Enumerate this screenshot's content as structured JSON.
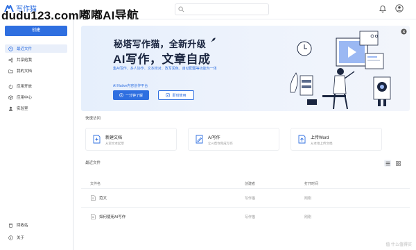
{
  "app": {
    "logo_text": "写作猫",
    "watermark": "dudu123.com嘟嘟AI导航"
  },
  "search": {
    "placeholder": ""
  },
  "sidebar": {
    "create_label": "创建",
    "items": [
      {
        "label": "最近文件",
        "icon": "clock-icon",
        "active": true
      },
      {
        "label": "共享给我",
        "icon": "share-icon",
        "active": false
      },
      {
        "label": "我的文档",
        "icon": "folder-icon",
        "active": false
      },
      {
        "label": "应用开放",
        "icon": "power-icon",
        "active": false
      },
      {
        "label": "应用中心",
        "icon": "box-icon",
        "active": false
      },
      {
        "label": "实验室",
        "icon": "user-icon",
        "active": false
      }
    ],
    "bottom_items": [
      {
        "label": "回收站",
        "icon": "trash-icon"
      },
      {
        "label": "关于",
        "icon": "info-icon"
      }
    ]
  },
  "banner": {
    "title1": "秘塔写作猫，全新升级",
    "title2": "AI写作，文章自成",
    "desc": "集AI写作、多人协作、文本校对、改写润色、自动配图等功能为一体",
    "sub": "AI Native内容创作平台",
    "btn1_label": "一分钟了解",
    "btn2_label": "即刻使用"
  },
  "quick_access": {
    "title": "快速访问",
    "cards": [
      {
        "title": "新建文档",
        "desc": "从空文本起草",
        "icon": "new-doc-icon"
      },
      {
        "title": "AI写作",
        "desc": "让AI帮你完成写作",
        "icon": "ai-write-icon"
      },
      {
        "title": "上传Word",
        "desc": "从本地上传文档",
        "icon": "upload-icon"
      }
    ]
  },
  "recent": {
    "title": "最近文件",
    "columns": [
      "文件名",
      "创建者",
      "打开时间"
    ],
    "rows": [
      {
        "name": "范文",
        "creator": "写作猫",
        "time": "刚刚"
      },
      {
        "name": "如何使用AI写作",
        "creator": "写作猫",
        "time": "刚刚"
      }
    ]
  },
  "footer": {
    "watermark": "值 什么值得买"
  },
  "colors": {
    "accent": "#2f6fe0",
    "banner_bg": "#e6effc"
  }
}
